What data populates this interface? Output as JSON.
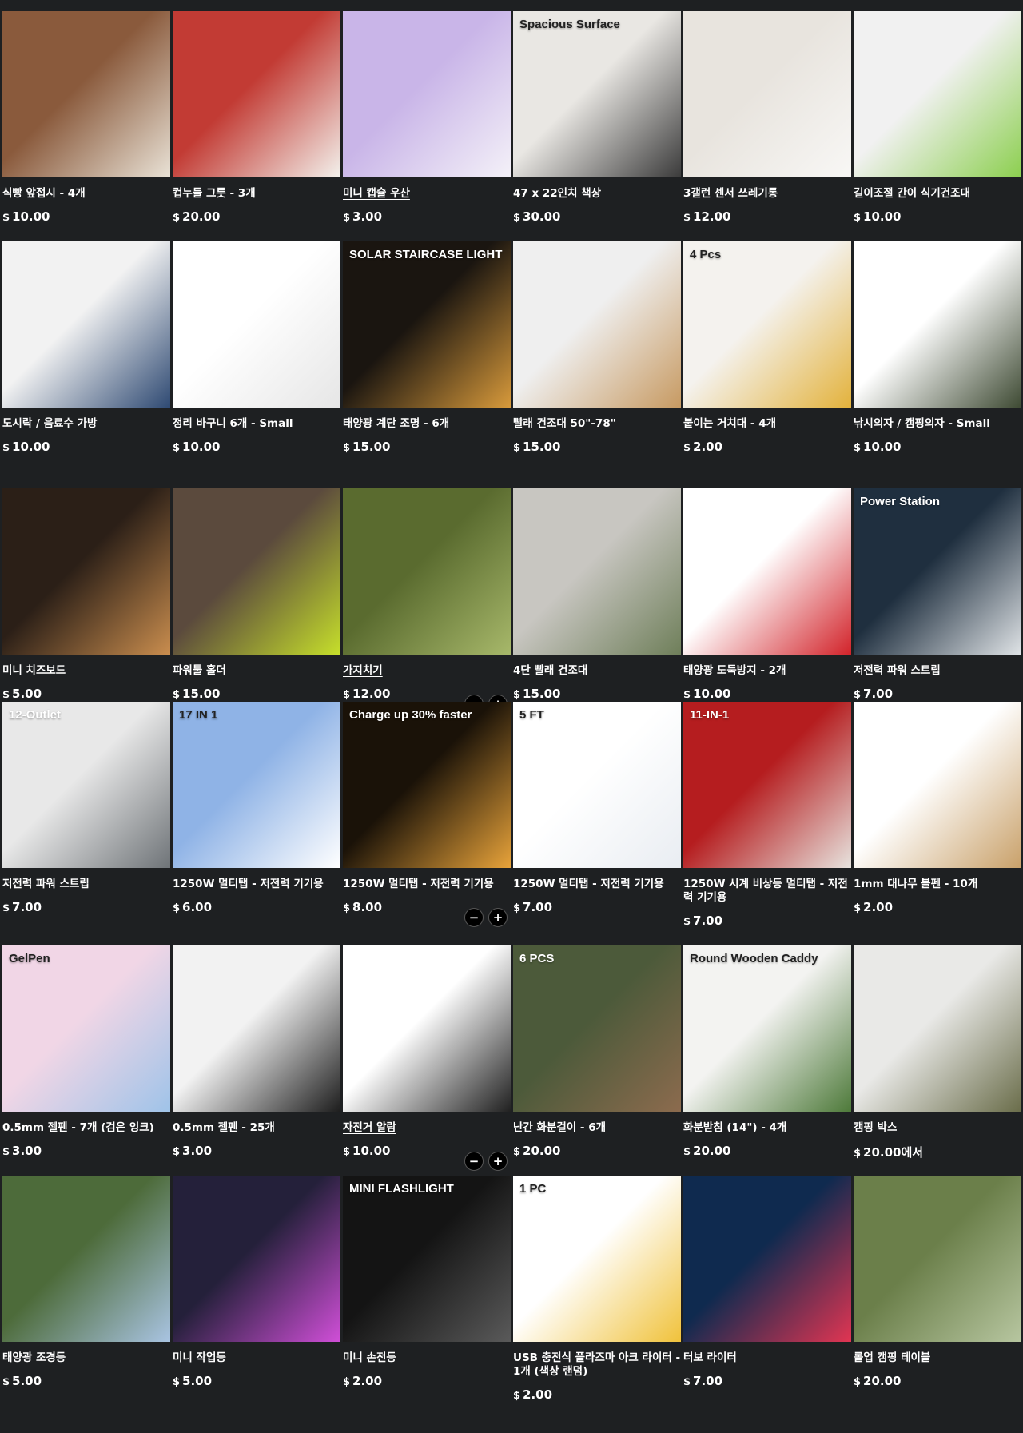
{
  "currency_symbol": "$",
  "products": [
    {
      "name": "식빵 앞접시 - 4개",
      "price": "10.00",
      "img_text": "",
      "img_colors": [
        "#8a5a3c",
        "#e9e2d6"
      ],
      "img_dark_text": false
    },
    {
      "name": "컵누들 그릇 - 3개",
      "price": "20.00",
      "img_text": "",
      "img_colors": [
        "#c23b34",
        "#f3f1ec"
      ],
      "img_dark_text": false
    },
    {
      "name": "미니 캡슐 우산",
      "price": "3.00",
      "img_text": "",
      "img_colors": [
        "#c9b5e8",
        "#f4f1f8"
      ],
      "img_dark_text": false,
      "underline": true
    },
    {
      "name": "47 x 22인치 책상",
      "price": "30.00",
      "img_text": "Spacious Surface",
      "img_colors": [
        "#e9e7e3",
        "#3b3b3b"
      ],
      "img_dark_text": true
    },
    {
      "name": "3갤런 센서 쓰레기통",
      "price": "12.00",
      "img_text": "",
      "img_colors": [
        "#e8e4de",
        "#f8f7f5"
      ],
      "img_dark_text": false
    },
    {
      "name": "길이조절 간이 식기건조대",
      "price": "10.00",
      "img_text": "",
      "img_colors": [
        "#f1f1f1",
        "#8ccf4f"
      ],
      "img_dark_text": false
    },
    {
      "name": "도시락 / 음료수 가방",
      "price": "10.00",
      "img_text": "",
      "img_colors": [
        "#f2f2f2",
        "#2f4a73"
      ],
      "img_dark_text": false
    },
    {
      "name": "정리 바구니 6개 - Small",
      "price": "10.00",
      "img_text": "",
      "img_colors": [
        "#ffffff",
        "#e6e6e6"
      ],
      "img_dark_text": false
    },
    {
      "name": "태양광 계단 조명 - 6개",
      "price": "15.00",
      "img_text": "SOLAR STAIRCASE LIGHT",
      "img_colors": [
        "#1a1510",
        "#d89a3b"
      ],
      "img_dark_text": false
    },
    {
      "name": "빨래 건조대 50\"-78\"",
      "price": "15.00",
      "img_text": "",
      "img_colors": [
        "#efefef",
        "#c79a62"
      ],
      "img_dark_text": false
    },
    {
      "name": "붙이는 거치대 - 4개",
      "price": "2.00",
      "img_text": "4 Pcs",
      "img_colors": [
        "#f4f2ee",
        "#e3b23c"
      ],
      "img_dark_text": true
    },
    {
      "name": "낚시의자 / 캠핑의자 - Small",
      "price": "10.00",
      "img_text": "",
      "img_colors": [
        "#ffffff",
        "#3e4a33"
      ],
      "img_dark_text": false
    },
    {
      "name": "미니 치즈보드",
      "price": "5.00",
      "img_text": "",
      "img_colors": [
        "#2b1f17",
        "#c98d4e"
      ],
      "img_dark_text": false
    },
    {
      "name": "파워툴 홀더",
      "price": "15.00",
      "img_text": "",
      "img_colors": [
        "#5b4a3d",
        "#c6df2b"
      ],
      "img_dark_text": false
    },
    {
      "name": "가지치기",
      "price": "12.00",
      "img_text": "",
      "img_colors": [
        "#5a6b2f",
        "#a7b86a"
      ],
      "img_dark_text": false,
      "underline": true,
      "stepper": true
    },
    {
      "name": "4단 빨래 건조대",
      "price": "15.00",
      "img_text": "",
      "img_colors": [
        "#c8c6c1",
        "#6f7f5a"
      ],
      "img_dark_text": false
    },
    {
      "name": "태양광 도둑방지 - 2개",
      "price": "10.00",
      "img_text": "",
      "img_colors": [
        "#ffffff",
        "#d2232a"
      ],
      "img_dark_text": false
    },
    {
      "name": "저전력 파워 스트립",
      "price": "7.00",
      "img_text": "Power Station",
      "img_colors": [
        "#1f2f3f",
        "#dfe3e6"
      ],
      "img_dark_text": false
    },
    {
      "name": "저전력 파워 스트립",
      "price": "7.00",
      "img_text": "12-Outlet",
      "img_colors": [
        "#e8e8e8",
        "#6f7478"
      ],
      "img_dark_text": false
    },
    {
      "name": "1250W 멀티탭 - 저전력 기기용",
      "price": "6.00",
      "img_text": "17 IN 1",
      "img_colors": [
        "#8fb3e6",
        "#ffffff"
      ],
      "img_dark_text": true
    },
    {
      "name": "1250W 멀티탭 - 저전력 기기용",
      "price": "8.00",
      "img_text": "Charge up 30% faster",
      "img_colors": [
        "#1a1208",
        "#e8a33a"
      ],
      "img_dark_text": false,
      "underline": true,
      "stepper": true
    },
    {
      "name": "1250W 멀티탭 - 저전력 기기용",
      "price": "7.00",
      "img_text": "5 FT",
      "img_colors": [
        "#ffffff",
        "#e9edf2"
      ],
      "img_dark_text": true
    },
    {
      "name": "1250W 시계 비상등 멀티탭 - 저전력 기기용",
      "price": "7.00",
      "img_text": "11-IN-1",
      "img_colors": [
        "#b51d1f",
        "#e7e3de"
      ],
      "img_dark_text": false
    },
    {
      "name": "1mm 대나무 볼펜 - 10개",
      "price": "2.00",
      "img_text": "",
      "img_colors": [
        "#ffffff",
        "#c9a16a"
      ],
      "img_dark_text": false
    },
    {
      "name": "0.5mm 젤펜 - 7개 (검은 잉크)",
      "price": "3.00",
      "img_text": "GelPen",
      "img_colors": [
        "#f1d6e6",
        "#9fc3e8"
      ],
      "img_dark_text": true
    },
    {
      "name": "0.5mm 젤펜 - 25개",
      "price": "3.00",
      "img_text": "",
      "img_colors": [
        "#f2f2f2",
        "#1d1d1d"
      ],
      "img_dark_text": false
    },
    {
      "name": "자전거 알람",
      "price": "10.00",
      "img_text": "",
      "img_colors": [
        "#ffffff",
        "#202020"
      ],
      "img_dark_text": false,
      "underline": true,
      "stepper": true
    },
    {
      "name": "난간 화분걸이 - 6개",
      "price": "20.00",
      "img_text": "6 PCS",
      "img_colors": [
        "#4c5a3a",
        "#8c6b4e"
      ],
      "img_dark_text": false
    },
    {
      "name": "화분받침 (14\") - 4개",
      "price": "20.00",
      "img_text": "Round Wooden Caddy",
      "img_colors": [
        "#f3f3f1",
        "#4e7a3a"
      ],
      "img_dark_text": true
    },
    {
      "name": "캠핑 박스",
      "price": "20.00에서",
      "img_text": "",
      "img_colors": [
        "#e9e9e7",
        "#6a6d4a"
      ],
      "img_dark_text": false
    },
    {
      "name": "태양광 조경등",
      "price": "5.00",
      "img_text": "",
      "img_colors": [
        "#4d6b3a",
        "#a9c4e2"
      ],
      "img_dark_text": false
    },
    {
      "name": "미니 작업등",
      "price": "5.00",
      "img_text": "",
      "img_colors": [
        "#24203a",
        "#d04fd8"
      ],
      "img_dark_text": false
    },
    {
      "name": "미니 손전등",
      "price": "2.00",
      "img_text": "MINI FLASHLIGHT",
      "img_colors": [
        "#141414",
        "#5a5a5a"
      ],
      "img_dark_text": false
    },
    {
      "name": "USB 충전식 플라즈마 아크 라이터 - 1개 (색상 랜덤)",
      "price": "2.00",
      "img_text": "1 PC",
      "img_colors": [
        "#ffffff",
        "#f0c23b"
      ],
      "img_dark_text": true
    },
    {
      "name": "터보 라이터",
      "price": "7.00",
      "img_text": "",
      "img_colors": [
        "#0f2a4f",
        "#e13552"
      ],
      "img_dark_text": false
    },
    {
      "name": "롤업 캠핑 테이블",
      "price": "20.00",
      "img_text": "",
      "img_colors": [
        "#6b7f4a",
        "#b7c6a0"
      ],
      "img_dark_text": false
    }
  ]
}
